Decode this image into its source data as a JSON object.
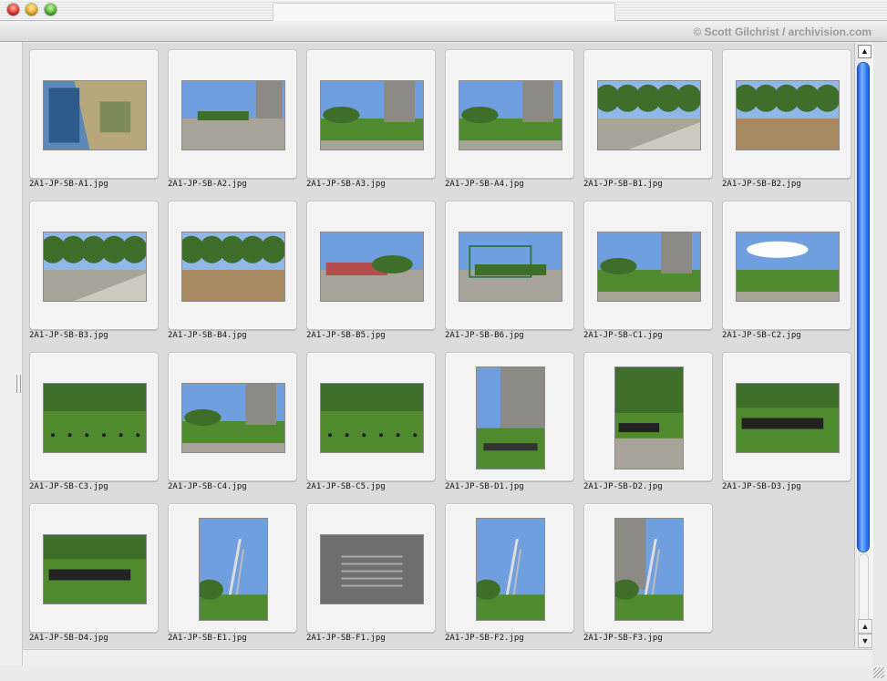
{
  "window": {
    "credit": "© Scott Gilchrist / archivision.com"
  },
  "images": [
    {
      "file": "2A1-JP-SB-A1.jpg",
      "scene": "aerial",
      "orientation": "landscape"
    },
    {
      "file": "2A1-JP-SB-A2.jpg",
      "scene": "street",
      "orientation": "landscape"
    },
    {
      "file": "2A1-JP-SB-A3.jpg",
      "scene": "park-tower",
      "orientation": "landscape"
    },
    {
      "file": "2A1-JP-SB-A4.jpg",
      "scene": "lawn-tower",
      "orientation": "landscape"
    },
    {
      "file": "2A1-JP-SB-B1.jpg",
      "scene": "trees-walk",
      "orientation": "landscape"
    },
    {
      "file": "2A1-JP-SB-B2.jpg",
      "scene": "trees-grove",
      "orientation": "landscape"
    },
    {
      "file": "2A1-JP-SB-B3.jpg",
      "scene": "trees-walk",
      "orientation": "landscape"
    },
    {
      "file": "2A1-JP-SB-B4.jpg",
      "scene": "trees-grove",
      "orientation": "landscape"
    },
    {
      "file": "2A1-JP-SB-B5.jpg",
      "scene": "planters",
      "orientation": "landscape"
    },
    {
      "file": "2A1-JP-SB-B6.jpg",
      "scene": "fence",
      "orientation": "landscape"
    },
    {
      "file": "2A1-JP-SB-C1.jpg",
      "scene": "lawn-tower",
      "orientation": "landscape"
    },
    {
      "file": "2A1-JP-SB-C2.jpg",
      "scene": "lawn-sky",
      "orientation": "landscape"
    },
    {
      "file": "2A1-JP-SB-C3.jpg",
      "scene": "lawn-birds",
      "orientation": "landscape"
    },
    {
      "file": "2A1-JP-SB-C4.jpg",
      "scene": "lawn-tower",
      "orientation": "landscape"
    },
    {
      "file": "2A1-JP-SB-C5.jpg",
      "scene": "lawn-birds",
      "orientation": "landscape"
    },
    {
      "file": "2A1-JP-SB-D1.jpg",
      "scene": "tower-portrait",
      "orientation": "portrait"
    },
    {
      "file": "2A1-JP-SB-D2.jpg",
      "scene": "walls-portrait",
      "orientation": "portrait"
    },
    {
      "file": "2A1-JP-SB-D3.jpg",
      "scene": "walls",
      "orientation": "landscape"
    },
    {
      "file": "2A1-JP-SB-D4.jpg",
      "scene": "walls",
      "orientation": "landscape"
    },
    {
      "file": "2A1-JP-SB-E1.jpg",
      "scene": "sculpture",
      "orientation": "portrait"
    },
    {
      "file": "2A1-JP-SB-F1.jpg",
      "scene": "plaque",
      "orientation": "landscape"
    },
    {
      "file": "2A1-JP-SB-F2.jpg",
      "scene": "sculpture",
      "orientation": "portrait"
    },
    {
      "file": "2A1-JP-SB-F3.jpg",
      "scene": "sculpture-tower",
      "orientation": "portrait"
    }
  ],
  "scrollbar": {
    "top_icon": "scroll-top-icon",
    "up_icon": "arrow-up-icon",
    "down_icon": "arrow-down-icon",
    "position_fraction": 0.0,
    "accent": "#3d86ff"
  },
  "colors": {
    "sky": "#6f9fde",
    "grass": "#4f8a2e",
    "tree": "#3f6e2a",
    "pavement": "#a9a49a",
    "building": "#8d8a86"
  }
}
